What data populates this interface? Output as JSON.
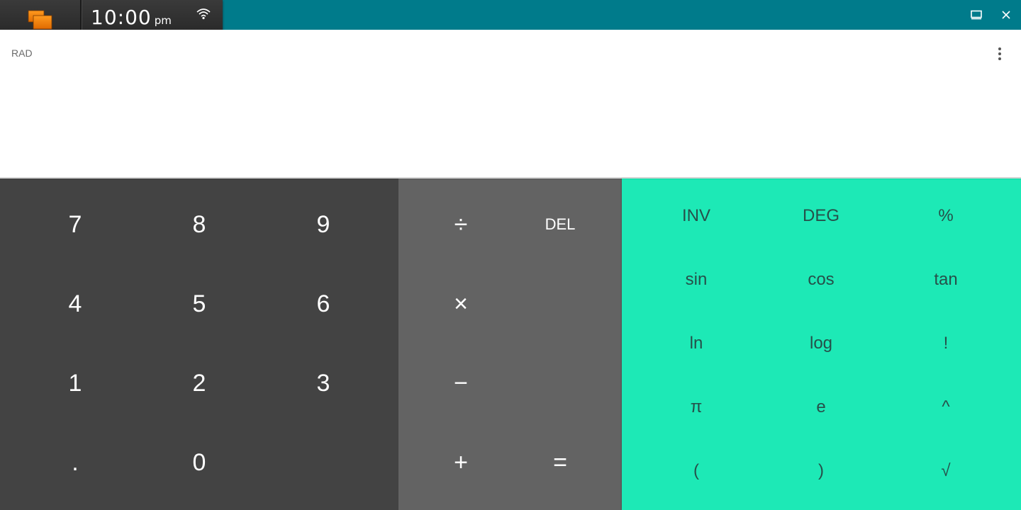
{
  "status": {
    "time": "10:00",
    "ampm": "pm"
  },
  "display": {
    "angle_mode": "RAD"
  },
  "numeric_pad": {
    "rows": [
      [
        "7",
        "8",
        "9"
      ],
      [
        "4",
        "5",
        "6"
      ],
      [
        "1",
        "2",
        "3"
      ],
      [
        ".",
        "0"
      ]
    ]
  },
  "operator_pad": {
    "divide": "÷",
    "delete": "DEL",
    "multiply": "×",
    "minus": "−",
    "plus": "+",
    "equals": "="
  },
  "advanced_pad": {
    "rows": [
      [
        "INV",
        "DEG",
        "%"
      ],
      [
        "sin",
        "cos",
        "tan"
      ],
      [
        "ln",
        "log",
        "!"
      ],
      [
        "π",
        "e",
        "^"
      ],
      [
        "(",
        ")",
        "√"
      ]
    ]
  },
  "colors": {
    "titlebar": "#007b8b",
    "numeric_pad": "#434343",
    "operator_pad": "#636363",
    "advanced_pad": "#1de9b6"
  },
  "icons": {
    "overview": "overview-windows-icon",
    "wifi": "wifi-icon",
    "restore": "restore-window-icon",
    "close": "close-icon",
    "menu": "more-vert-icon"
  }
}
